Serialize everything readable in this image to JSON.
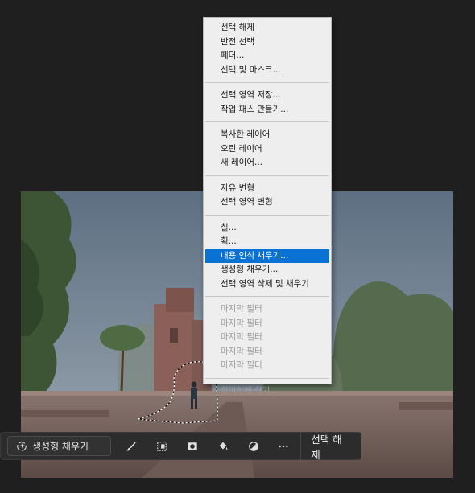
{
  "menu": {
    "groups": [
      [
        "선택 해제",
        "반전 선택",
        "페더...",
        "선택 및 마스크..."
      ],
      [
        "선택 영역 저장...",
        "작업 패스 만들기..."
      ],
      [
        "복사한 레이어",
        "오린 레이어",
        "새 레이어..."
      ],
      [
        "자유 변형",
        "선택 영역 변형"
      ],
      [
        "칠...",
        "획...",
        "내용 인식 채우기...",
        "생성형 채우기...",
        "선택 영역 삭제 및 채우기"
      ],
      [
        "마지막 필터",
        "마지막 필터",
        "마지막 필터",
        "마지막 필터",
        "마지막 필터"
      ],
      [
        "희미하게 하기..."
      ]
    ],
    "highlighted": "내용 인식 채우기...",
    "highlight_color": "#0a72d4"
  },
  "taskbar": {
    "generative_fill_label": "생성형 채우기",
    "deselect_label": "선택 해제",
    "icons": [
      "sparkle-icon",
      "brush-icon",
      "transform-icon",
      "mask-icon",
      "fill-bucket-icon",
      "contrast-icon",
      "more-icon"
    ]
  }
}
